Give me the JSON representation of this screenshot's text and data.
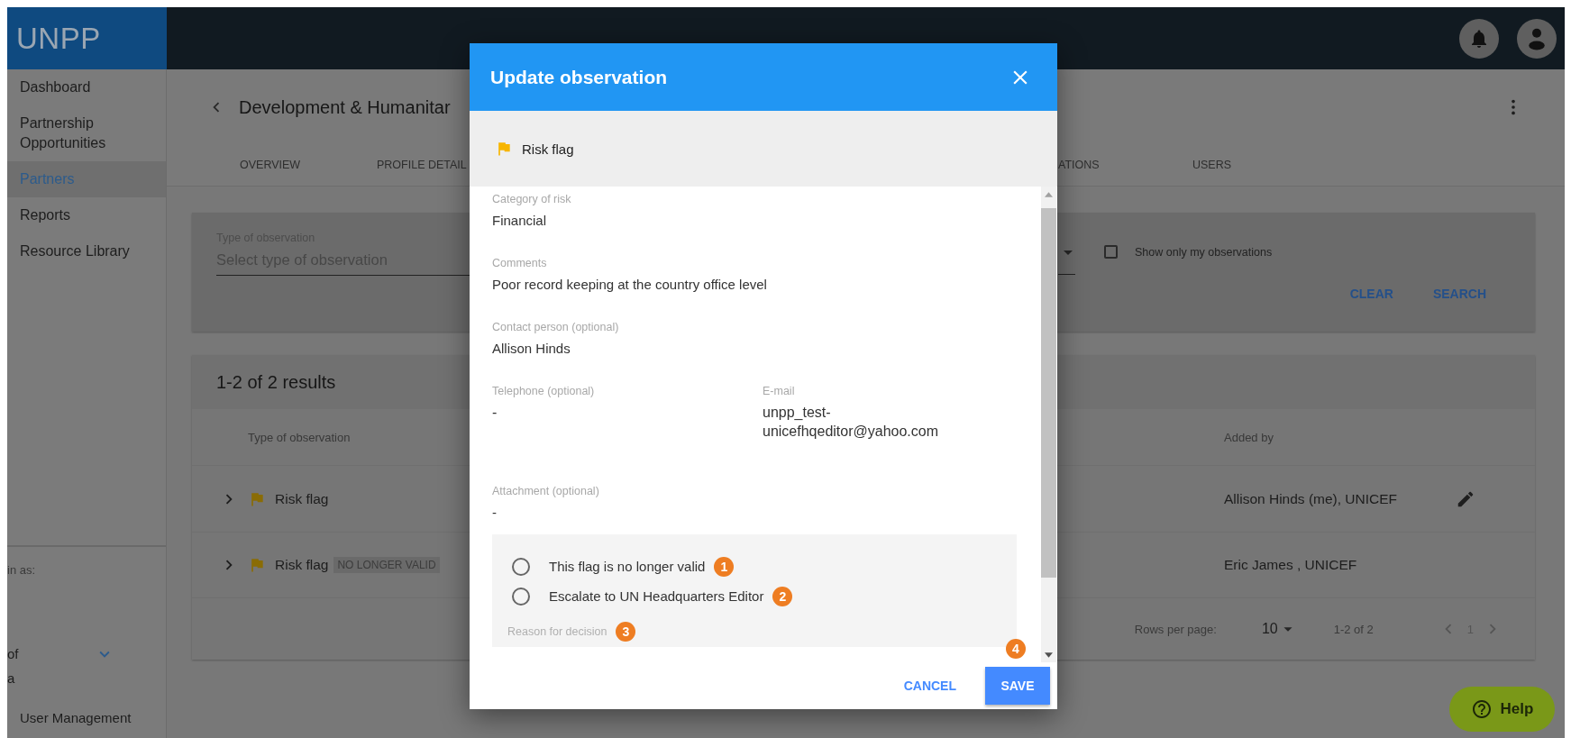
{
  "app": {
    "logo": "UNPP"
  },
  "sidebar": {
    "items": [
      {
        "label": "Dashboard",
        "selected": false
      },
      {
        "label": "Partnership Opportunities",
        "selected": false
      },
      {
        "label": "Partners",
        "selected": true
      },
      {
        "label": "Reports",
        "selected": false
      },
      {
        "label": "Resource Library",
        "selected": false
      }
    ],
    "account": {
      "label": "in as:",
      "org_lines": [
        "of",
        "a"
      ]
    },
    "admin_items": [
      {
        "label": "User Management",
        "selected": false
      }
    ]
  },
  "page": {
    "title": "Development & Humanitar",
    "tabs": [
      {
        "label": "OVERVIEW",
        "selected": false
      },
      {
        "label": "PROFILE DETAIL",
        "selected": false
      },
      {
        "label": "ATIONS",
        "selected": false
      },
      {
        "label": "USERS",
        "selected": false
      }
    ]
  },
  "filters": {
    "type_field": {
      "label": "Type of observation",
      "placeholder": "Select type of observation"
    },
    "show_mine": {
      "label": "Show only my observations",
      "checked": false
    },
    "buttons": [
      "CLEAR",
      "SEARCH"
    ]
  },
  "results": {
    "heading": "1-2 of 2 results",
    "columns": [
      "Type of observation",
      "Added by"
    ],
    "rows": [
      {
        "type": "Risk flag",
        "added_by": "Allison Hinds (me), UNICEF",
        "expanded": false,
        "editable": true
      },
      {
        "type": "Risk flag",
        "tag": "NO LONGER VALID",
        "added_by": "Eric James , UNICEF",
        "expanded": false,
        "editable": false
      }
    ],
    "pagination": {
      "rows_per_page_label": "Rows per page:",
      "rows_per_page": "10",
      "range": "1-2 of 2",
      "page": "1"
    }
  },
  "modal": {
    "title": "Update observation",
    "observation_type": "Risk flag",
    "field_rows": [
      [
        {
          "label": "Category of risk",
          "value": "Financial"
        }
      ],
      [
        {
          "label": "Comments",
          "value": "Poor record keeping at the country office level"
        }
      ],
      [
        {
          "label": "Contact person (optional)",
          "value": "Allison Hinds"
        }
      ],
      [
        {
          "label": "Telephone (optional)",
          "value": "-"
        },
        {
          "label": "E-mail",
          "value": "unpp_test-unicefhqeditor@yahoo.com"
        }
      ],
      [
        {
          "label": "Attachment (optional)",
          "value": "-"
        }
      ]
    ],
    "decision": {
      "options": [
        {
          "label": "This flag is no longer valid",
          "selected": false,
          "marker": "1"
        },
        {
          "label": "Escalate to UN Headquarters Editor",
          "selected": false,
          "marker": "2"
        }
      ],
      "reason_label": "Reason for decision",
      "reason_marker": "3"
    },
    "buttons": [
      {
        "label": "CANCEL",
        "kind": "text"
      },
      {
        "label": "SAVE",
        "kind": "raised",
        "marker": "4"
      }
    ]
  },
  "help": {
    "label": "Help"
  }
}
